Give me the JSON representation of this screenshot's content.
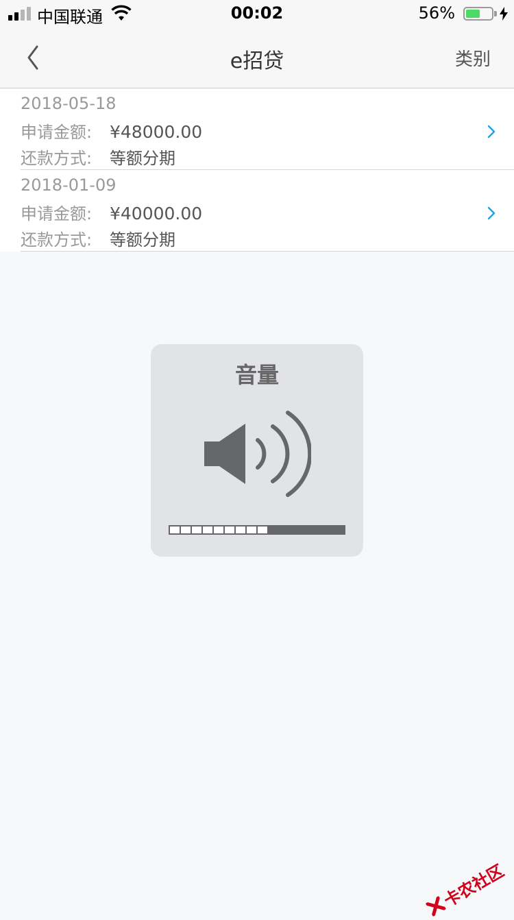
{
  "status_bar": {
    "carrier": "中国联通",
    "time": "00:02",
    "battery_percent_label": "56%",
    "battery_level": 0.56
  },
  "nav": {
    "title": "e招贷",
    "right_label": "类别"
  },
  "loans": [
    {
      "date": "2018-05-18",
      "amount_label": "申请金额:",
      "amount": "¥48000.00",
      "repay_label": "还款方式:",
      "repay_method": "等额分期"
    },
    {
      "date": "2018-01-09",
      "amount_label": "申请金额:",
      "amount": "¥40000.00",
      "repay_label": "还款方式:",
      "repay_method": "等额分期"
    }
  ],
  "volume_hud": {
    "title": "音量",
    "level_segments": 9,
    "total_segments": 16
  },
  "watermark": {
    "text": "卡农社区"
  },
  "colors": {
    "accent_chevron": "#1aa3e8",
    "battery_fill": "#4cd964",
    "watermark_red": "#d0021b"
  }
}
